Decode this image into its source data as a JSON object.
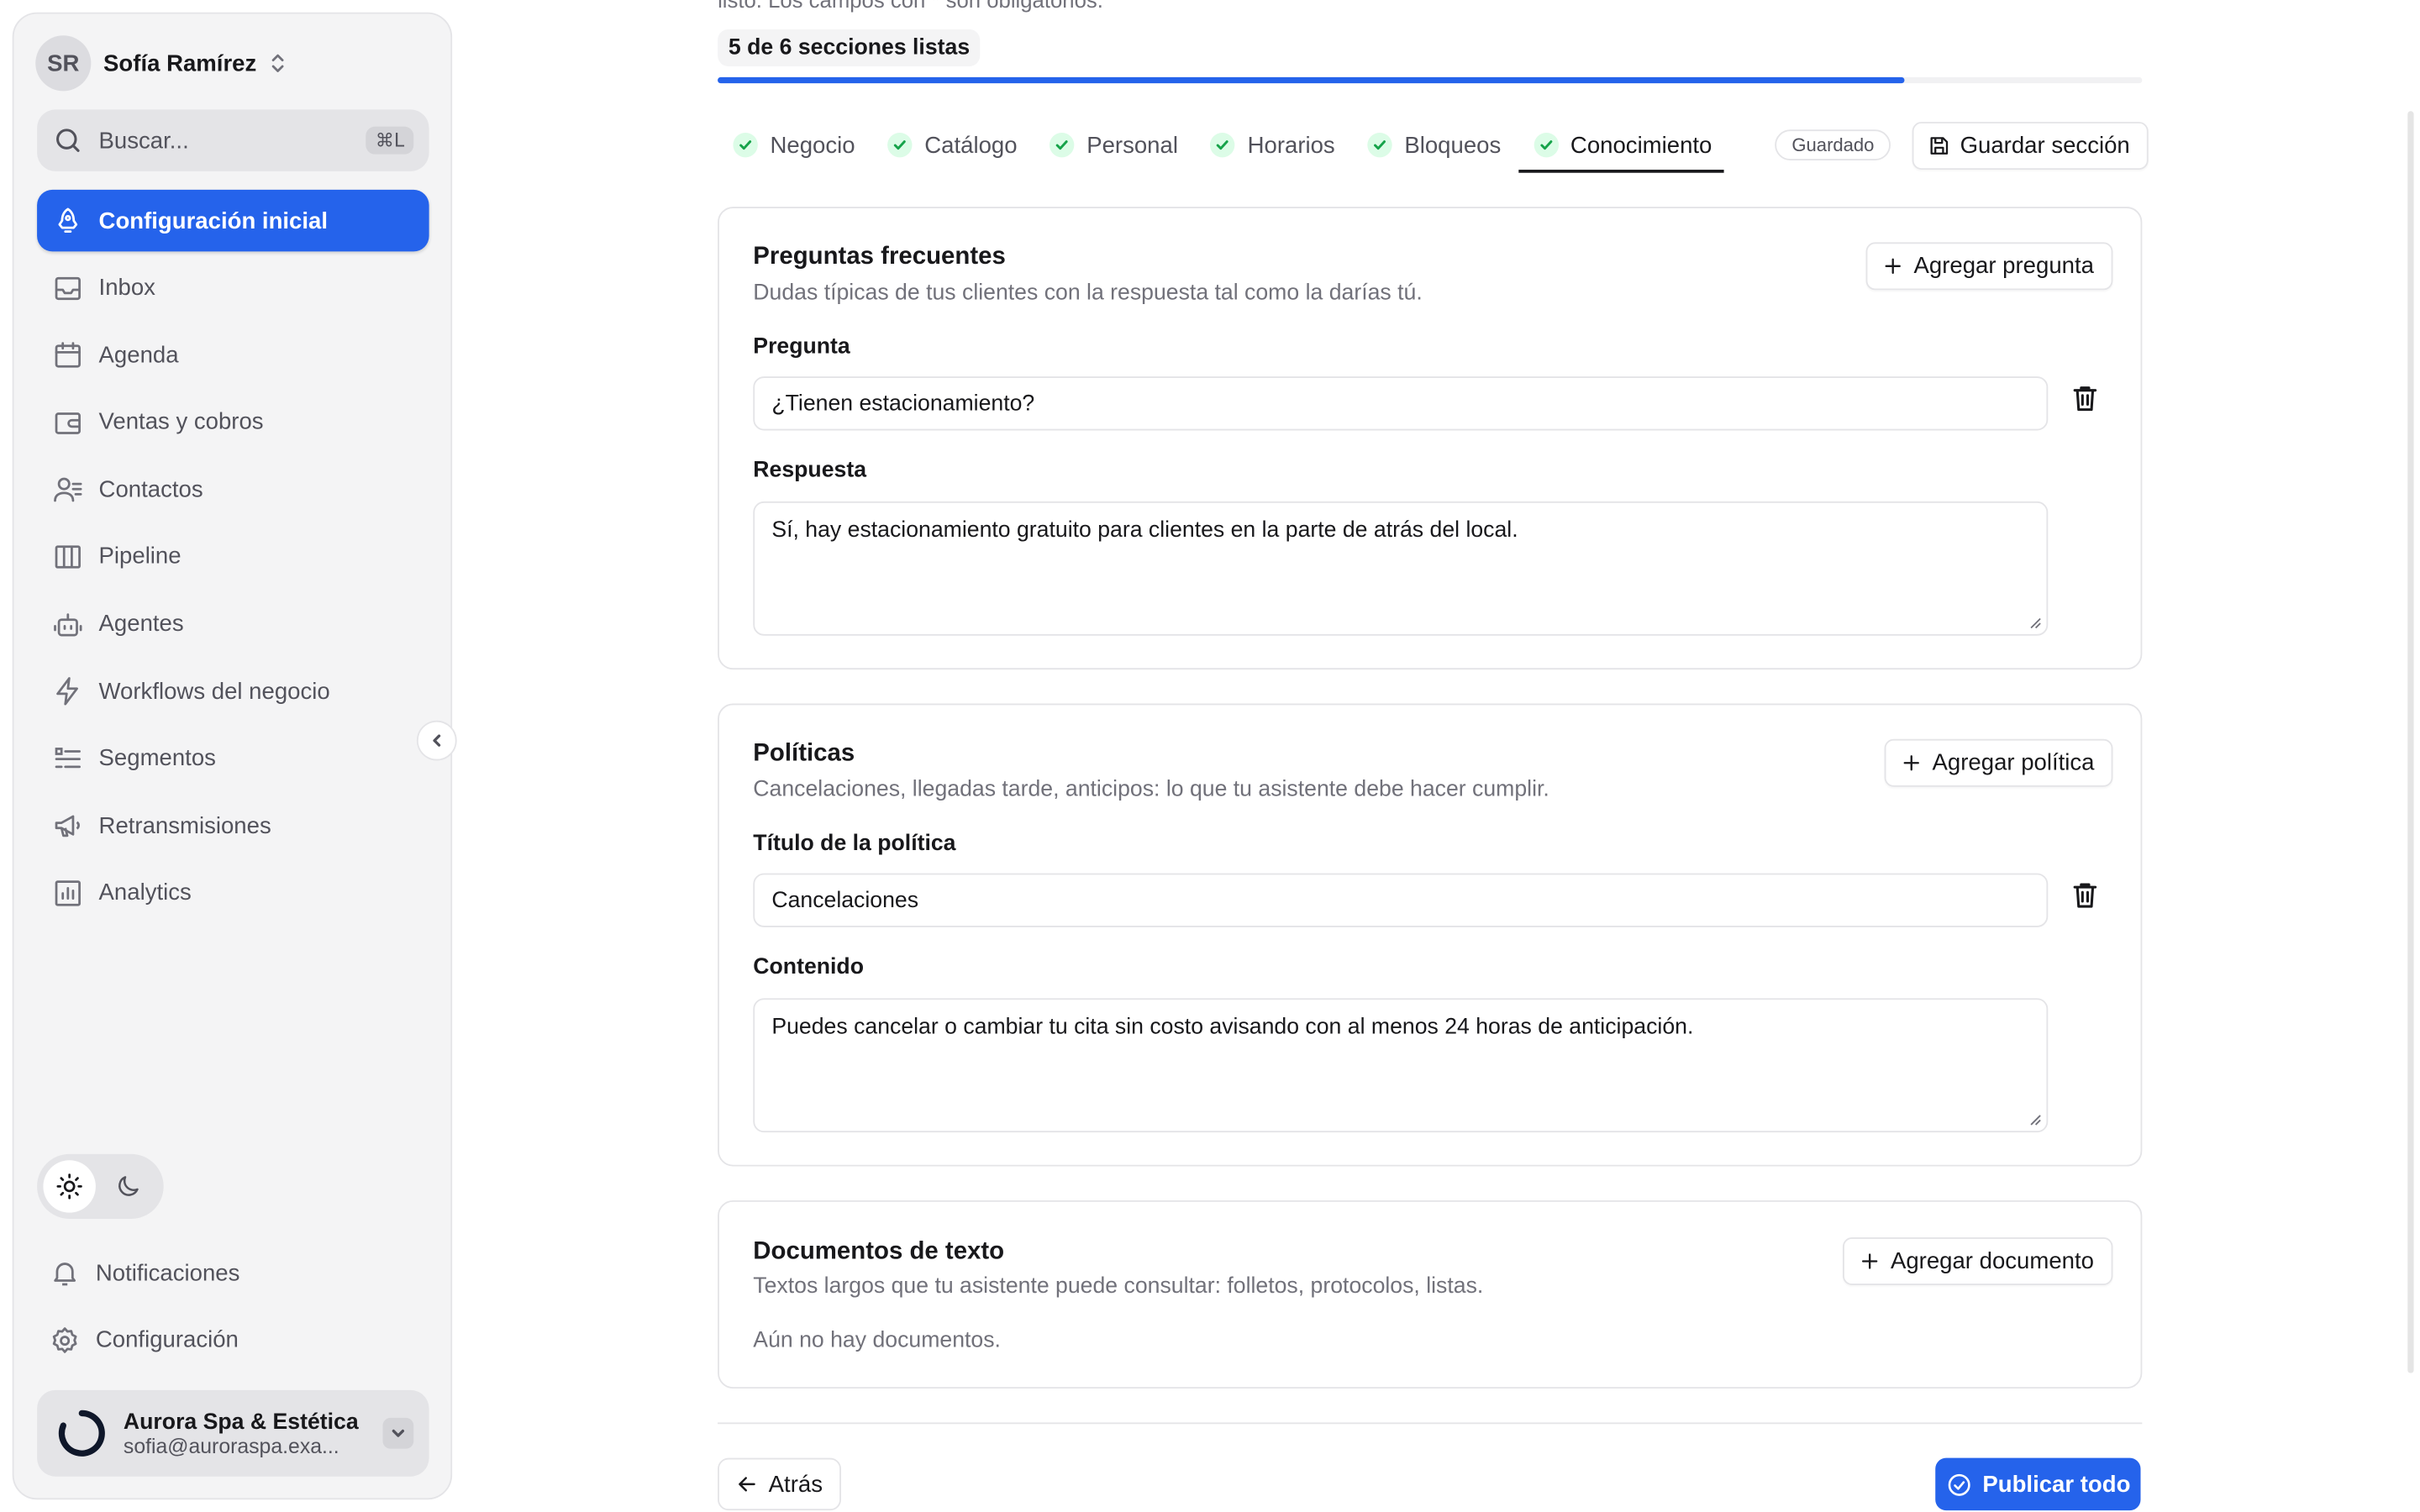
{
  "sidebar": {
    "user": {
      "initials": "SR",
      "name": "Sofía Ramírez"
    },
    "search": {
      "placeholder": "Buscar...",
      "shortcut": "⌘L"
    },
    "items": [
      {
        "label": "Configuración inicial",
        "icon": "rocket-icon",
        "active": true
      },
      {
        "label": "Inbox",
        "icon": "inbox-icon"
      },
      {
        "label": "Agenda",
        "icon": "calendar-icon"
      },
      {
        "label": "Ventas y cobros",
        "icon": "wallet-icon"
      },
      {
        "label": "Contactos",
        "icon": "contacts-icon"
      },
      {
        "label": "Pipeline",
        "icon": "columns-icon"
      },
      {
        "label": "Agentes",
        "icon": "bot-icon"
      },
      {
        "label": "Workflows del negocio",
        "icon": "zap-icon"
      },
      {
        "label": "Segmentos",
        "icon": "list-filter-icon"
      },
      {
        "label": "Retransmisiones",
        "icon": "megaphone-icon"
      },
      {
        "label": "Analytics",
        "icon": "bar-chart-icon"
      }
    ],
    "bottom_items": [
      {
        "label": "Notificaciones",
        "icon": "bell-icon"
      },
      {
        "label": "Configuración",
        "icon": "gear-icon"
      }
    ],
    "theme": {
      "selected": "light"
    },
    "workspace": {
      "name": "Aurora Spa & Estética",
      "email": "sofia@auroraspa.exa..."
    }
  },
  "header": {
    "cut_text": "listo. Los campos con * son obligatorios.",
    "progress_label": "5 de 6 secciones listas",
    "progress_fraction": 0.833
  },
  "tabs": [
    {
      "label": "Negocio",
      "done": true
    },
    {
      "label": "Catálogo",
      "done": true
    },
    {
      "label": "Personal",
      "done": true
    },
    {
      "label": "Horarios",
      "done": true
    },
    {
      "label": "Bloqueos",
      "done": true
    },
    {
      "label": "Conocimiento",
      "done": true,
      "active": true
    }
  ],
  "status": {
    "saved_label": "Guardado",
    "save_section_label": "Guardar sección"
  },
  "faq": {
    "title": "Preguntas frecuentes",
    "description": "Dudas típicas de tus clientes con la respuesta tal como la darías tú.",
    "add_label": "Agregar pregunta",
    "question_label": "Pregunta",
    "question_value": "¿Tienen estacionamiento?",
    "answer_label": "Respuesta",
    "answer_value": "Sí, hay estacionamiento gratuito para clientes en la parte de atrás del local."
  },
  "policies": {
    "title": "Políticas",
    "description": "Cancelaciones, llegadas tarde, anticipos: lo que tu asistente debe hacer cumplir.",
    "add_label": "Agregar política",
    "title_label": "Título de la política",
    "title_value": "Cancelaciones",
    "content_label": "Contenido",
    "content_value": "Puedes cancelar o cambiar tu cita sin costo avisando con al menos 24 horas de anticipación."
  },
  "documents": {
    "title": "Documentos de texto",
    "description": "Textos largos que tu asistente puede consultar: folletos, protocolos, listas.",
    "add_label": "Agregar documento",
    "empty_label": "Aún no hay documentos."
  },
  "footer": {
    "back_label": "Atrás",
    "publish_label": "Publicar todo"
  },
  "colors": {
    "accent": "#2563eb",
    "success": "#16a34a"
  }
}
